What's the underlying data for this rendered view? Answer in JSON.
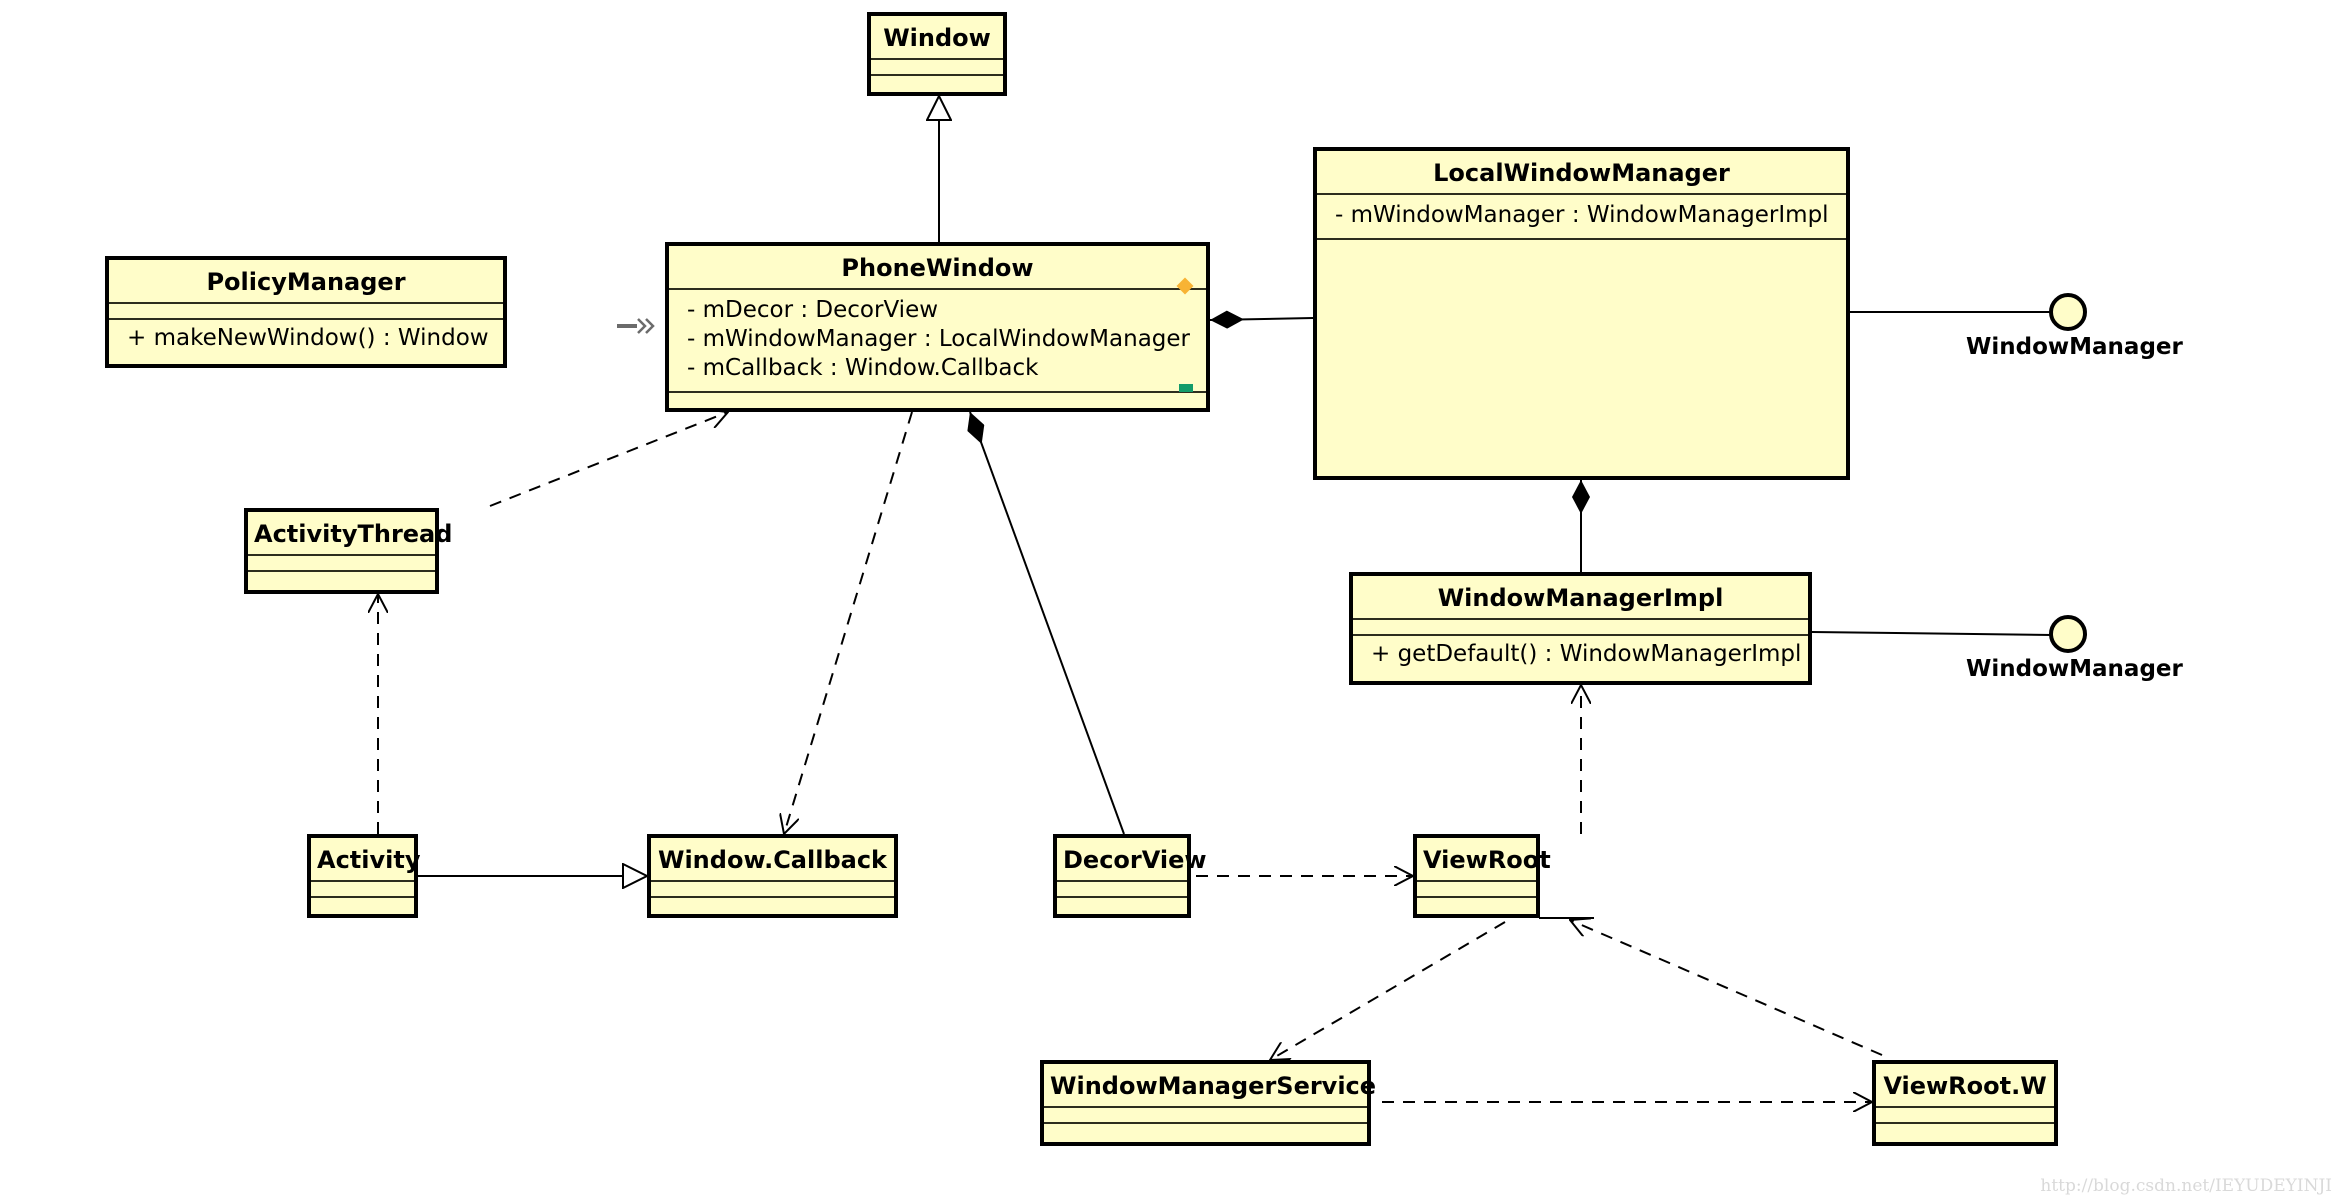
{
  "diagram": {
    "type": "UML class diagram",
    "classes": {
      "window": {
        "name": "Window",
        "attributes": [],
        "operations": []
      },
      "phone_window": {
        "name": "PhoneWindow",
        "attributes": [
          "- mDecor : DecorView",
          "- mWindowManager : LocalWindowManager",
          "- mCallback : Window.Callback"
        ],
        "operations": []
      },
      "policy_manager": {
        "name": "PolicyManager",
        "attributes": [],
        "operations": [
          "+ makeNewWindow() : Window"
        ]
      },
      "local_window_manager": {
        "name": "LocalWindowManager",
        "attributes": [
          "- mWindowManager : WindowManagerImpl"
        ],
        "operations": []
      },
      "window_manager_impl": {
        "name": "WindowManagerImpl",
        "attributes": [],
        "operations": [
          "+ getDefault() : WindowManagerImpl"
        ]
      },
      "activity_thread": {
        "name": "ActivityThread",
        "attributes": [],
        "operations": []
      },
      "activity": {
        "name": "Activity",
        "attributes": [],
        "operations": []
      },
      "window_callback": {
        "name": "Window.Callback",
        "attributes": [],
        "operations": []
      },
      "decor_view": {
        "name": "DecorView",
        "attributes": [],
        "operations": []
      },
      "view_root": {
        "name": "ViewRoot",
        "attributes": [],
        "operations": []
      },
      "window_manager_service": {
        "name": "WindowManagerService",
        "attributes": [],
        "operations": []
      },
      "view_root_w": {
        "name": "ViewRoot.W",
        "attributes": [],
        "operations": []
      }
    },
    "interfaces": [
      {
        "id": "wm_iface_1",
        "name": "WindowManager",
        "implemented_by": "LocalWindowManager"
      },
      {
        "id": "wm_iface_2",
        "name": "WindowManager",
        "implemented_by": "WindowManagerImpl"
      }
    ],
    "relationships": [
      {
        "type": "generalization",
        "from": "PhoneWindow",
        "to": "Window"
      },
      {
        "type": "composition",
        "whole": "PhoneWindow",
        "part": "LocalWindowManager"
      },
      {
        "type": "composition",
        "whole": "PhoneWindow",
        "part": "DecorView"
      },
      {
        "type": "composition",
        "whole": "LocalWindowManager",
        "part": "WindowManagerImpl"
      },
      {
        "type": "dependency",
        "from": "ActivityThread",
        "to": "PhoneWindow"
      },
      {
        "type": "dependency",
        "from": "PhoneWindow",
        "to": "Window.Callback"
      },
      {
        "type": "dependency",
        "from": "Activity",
        "to": "ActivityThread"
      },
      {
        "type": "realization",
        "from": "Activity",
        "to": "Window.Callback"
      },
      {
        "type": "dependency",
        "from": "DecorView",
        "to": "ViewRoot"
      },
      {
        "type": "dependency",
        "from": "ViewRoot",
        "to": "WindowManagerImpl"
      },
      {
        "type": "dependency",
        "from": "ViewRoot",
        "to": "WindowManagerService"
      },
      {
        "type": "dependency",
        "from": "ViewRoot.W",
        "to": "ViewRoot"
      },
      {
        "type": "dependency",
        "from": "WindowManagerService",
        "to": "ViewRoot.W"
      }
    ],
    "colors": {
      "class_fill": "#fffdc9",
      "border": "#000000",
      "marker_orange": "#f8b334",
      "marker_green": "#139b6a",
      "watermark": "#d9d9d9"
    }
  },
  "watermark": "http://blog.csdn.net/IEYUDEYINJI"
}
